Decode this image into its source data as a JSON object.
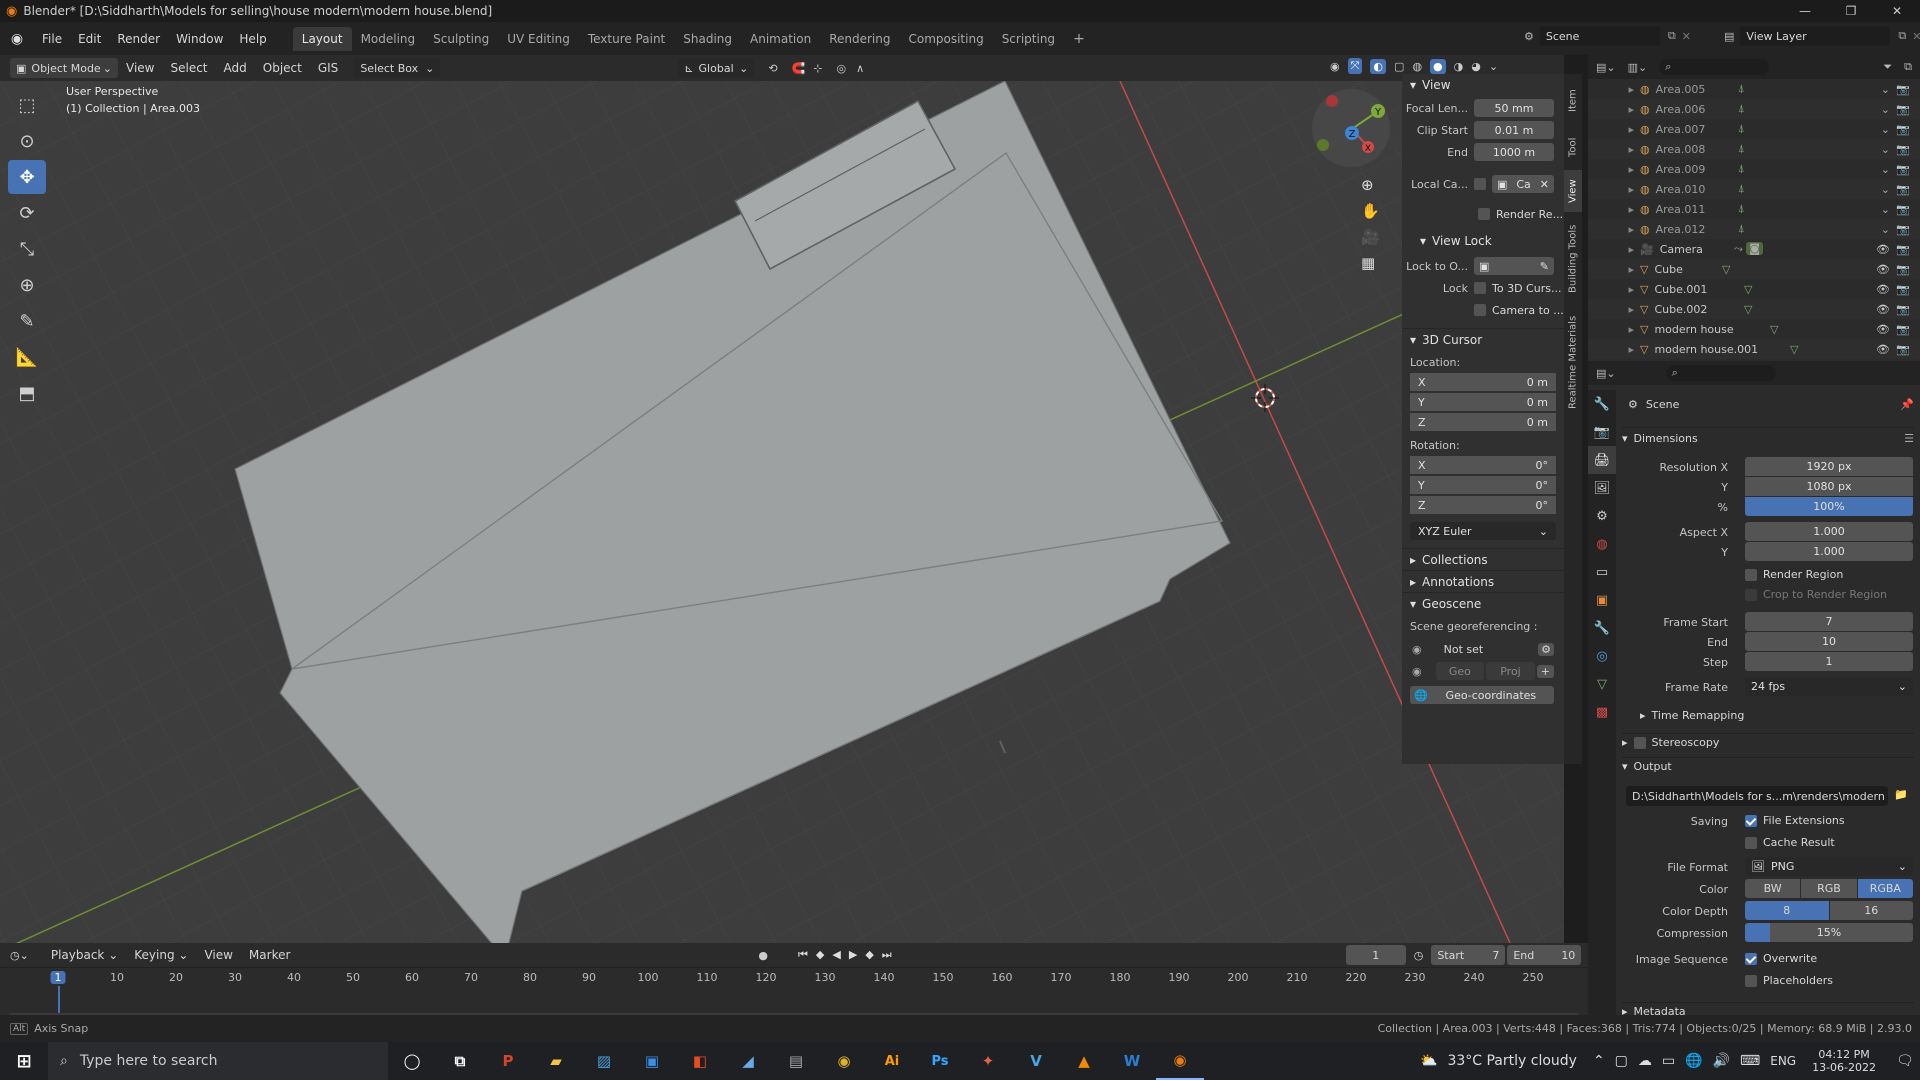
{
  "title": "Blender* [D:\\Siddharth\\Models for selling\\house modern\\modern house.blend]",
  "menus": [
    "File",
    "Edit",
    "Render",
    "Window",
    "Help"
  ],
  "workspaces": [
    "Layout",
    "Modeling",
    "Sculpting",
    "UV Editing",
    "Texture Paint",
    "Shading",
    "Animation",
    "Rendering",
    "Compositing",
    "Scripting"
  ],
  "active_workspace": "Layout",
  "scene_name": "Scene",
  "view_layer": "View Layer",
  "header": {
    "mode": "Object Mode",
    "view": "View",
    "select": "Select",
    "add": "Add",
    "object": "Object",
    "gis": "GIS",
    "select_box": "Select Box",
    "transform_orientation": "Global"
  },
  "viewport": {
    "line1": "User Perspective",
    "line2": "(1) Collection | Area.003"
  },
  "npanel": {
    "view_title": "View",
    "focal_label": "Focal Len...",
    "focal_value": "50 mm",
    "clip_start_label": "Clip Start",
    "clip_start_value": "0.01 m",
    "end_label": "End",
    "end_value": "1000 m",
    "local_cam_label": "Local Ca...",
    "local_cam_value": "Ca",
    "render_region": "Render Re...",
    "view_lock_title": "View Lock",
    "lock_to_label": "Lock to O...",
    "lock_label": "Lock",
    "to_3d_cursor": "To 3D Curs...",
    "camera_to": "Camera to ...",
    "cursor_title": "3D Cursor",
    "location_label": "Location:",
    "rotation_label": "Rotation:",
    "loc": [
      {
        "axis": "X",
        "value": "0 m"
      },
      {
        "axis": "Y",
        "value": "0 m"
      },
      {
        "axis": "Z",
        "value": "0 m"
      }
    ],
    "rot": [
      {
        "axis": "X",
        "value": "0°"
      },
      {
        "axis": "Y",
        "value": "0°"
      },
      {
        "axis": "Z",
        "value": "0°"
      }
    ],
    "euler": "XYZ Euler",
    "collections": "Collections",
    "annotations": "Annotations",
    "geoscene": "Geoscene",
    "georef_label": "Scene georeferencing :",
    "not_set": "Not set",
    "geo": "Geo",
    "proj": "Proj",
    "geo_coordinates": "Geo-coordinates",
    "tabs": [
      "Item",
      "Tool",
      "View",
      "Building Tools",
      "Realtime Materials"
    ]
  },
  "outliner": {
    "items": [
      "Area.005",
      "Area.006",
      "Area.007",
      "Area.008",
      "Area.009",
      "Area.010",
      "Area.011",
      "Area.012",
      "Camera",
      "Cube",
      "Cube.001",
      "Cube.002",
      "modern house",
      "modern house.001"
    ]
  },
  "properties": {
    "context": "Scene",
    "dimensions": "Dimensions",
    "res_x_label": "Resolution X",
    "res_x": "1920 px",
    "res_y_label": "Y",
    "res_y": "1080 px",
    "pct_label": "%",
    "pct": "100%",
    "aspect_x_label": "Aspect X",
    "aspect_x": "1.000",
    "aspect_y_label": "Y",
    "aspect_y": "1.000",
    "render_region": "Render Region",
    "crop": "Crop to Render Region",
    "frame_start_label": "Frame Start",
    "frame_start": "7",
    "frame_end_label": "End",
    "frame_end": "10",
    "step_label": "Step",
    "step": "1",
    "frame_rate_label": "Frame Rate",
    "frame_rate": "24 fps",
    "time_remapping": "Time Remapping",
    "stereoscopy": "Stereoscopy",
    "output": "Output",
    "output_path": "D:\\Siddharth\\Models for s...m\\renders\\modern house",
    "saving_label": "Saving",
    "file_extensions": "File Extensions",
    "cache_result": "Cache Result",
    "file_format_label": "File Format",
    "file_format": "PNG",
    "color_label": "Color",
    "color_opts": [
      "BW",
      "RGB",
      "RGBA"
    ],
    "color_depth_label": "Color Depth",
    "depth_opts": [
      "8",
      "16"
    ],
    "compression_label": "Compression",
    "compression": "15%",
    "compression_frac": 0.15,
    "image_sequence_label": "Image Sequence",
    "overwrite": "Overwrite",
    "placeholders": "Placeholders",
    "metadata": "Metadata"
  },
  "timeline": {
    "playback": "Playback",
    "keying": "Keying",
    "view": "View",
    "marker": "Marker",
    "current_frame": "1",
    "start_label": "Start",
    "start": "7",
    "end_label": "End",
    "end": "10",
    "ticks": [
      "1",
      "10",
      "20",
      "30",
      "40",
      "50",
      "60",
      "70",
      "80",
      "90",
      "100",
      "110",
      "120",
      "130",
      "140",
      "150",
      "160",
      "170",
      "180",
      "190",
      "200",
      "210",
      "220",
      "230",
      "240",
      "250"
    ]
  },
  "status": {
    "left": "Axis Snap",
    "right": "Collection | Area.003 | Verts:448 | Faces:368 | Tris:774 | Objects:0/25 | Memory: 68.9 MiB | 2.93.0"
  },
  "taskbar": {
    "search": "Type here to search",
    "weather": "33°C  Partly cloudy",
    "lang": "ENG",
    "time": "04:12 PM",
    "date": "13-06-2022"
  },
  "colors": {
    "accent": "#4772b3",
    "x_axis": "#d04a4a",
    "y_axis": "#7fa83a",
    "z_axis": "#3b86d6",
    "mesh": "#9fa1a2"
  }
}
